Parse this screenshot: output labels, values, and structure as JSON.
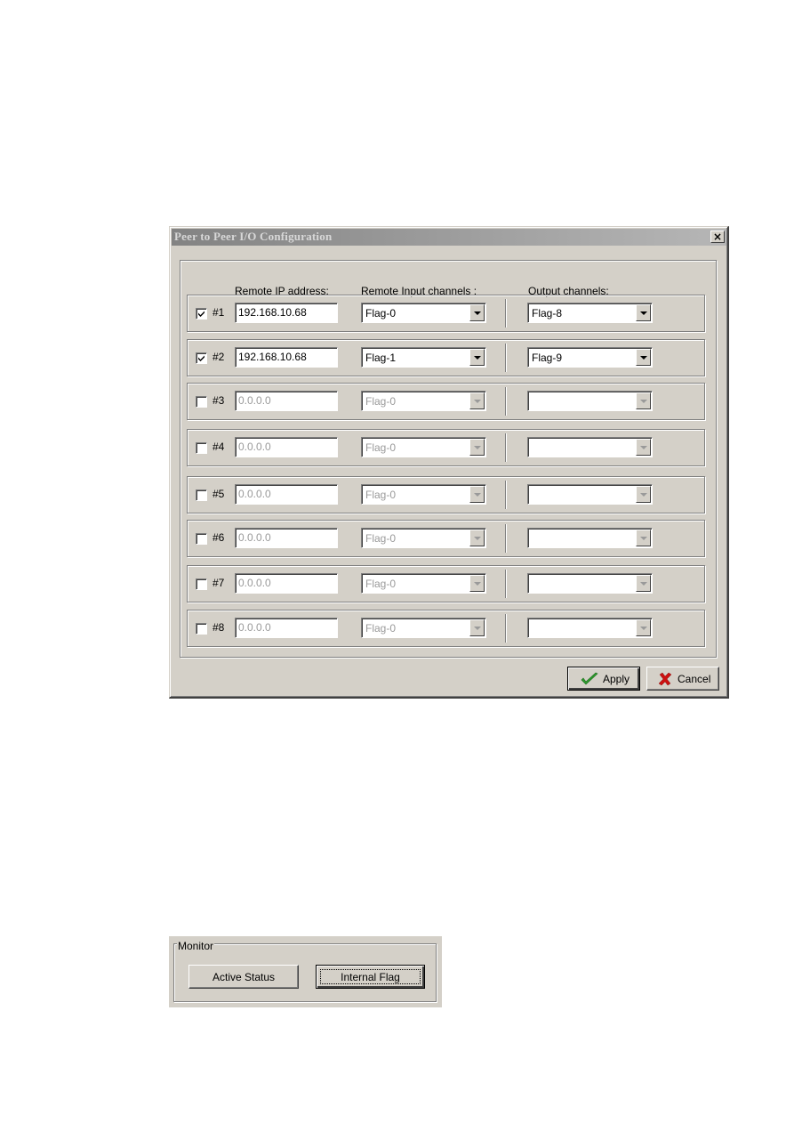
{
  "dialog": {
    "title": "Peer to Peer I/O Configuration",
    "close_label": "×",
    "headers": {
      "ip": "Remote IP address:",
      "input": "Remote Input channels :",
      "output": "Output channels:"
    },
    "rows": [
      {
        "label": "#1",
        "enabled": true,
        "ip": "192.168.10.68",
        "input": "Flag-0",
        "output": "Flag-8"
      },
      {
        "label": "#2",
        "enabled": true,
        "ip": "192.168.10.68",
        "input": "Flag-1",
        "output": "Flag-9"
      },
      {
        "label": "#3",
        "enabled": false,
        "ip": "0.0.0.0",
        "input": "Flag-0",
        "output": ""
      },
      {
        "label": "#4",
        "enabled": false,
        "ip": "0.0.0.0",
        "input": "Flag-0",
        "output": ""
      },
      {
        "label": "#5",
        "enabled": false,
        "ip": "0.0.0.0",
        "input": "Flag-0",
        "output": ""
      },
      {
        "label": "#6",
        "enabled": false,
        "ip": "0.0.0.0",
        "input": "Flag-0",
        "output": ""
      },
      {
        "label": "#7",
        "enabled": false,
        "ip": "0.0.0.0",
        "input": "Flag-0",
        "output": ""
      },
      {
        "label": "#8",
        "enabled": false,
        "ip": "0.0.0.0",
        "input": "Flag-0",
        "output": ""
      }
    ],
    "buttons": {
      "apply": "Apply",
      "cancel": "Cancel"
    },
    "colors": {
      "apply_check": "#2e9a2e",
      "cancel_x": "#cc1111"
    }
  },
  "monitor": {
    "legend": "Monitor",
    "active_status": "Active Status",
    "internal_flag": "Internal Flag"
  }
}
